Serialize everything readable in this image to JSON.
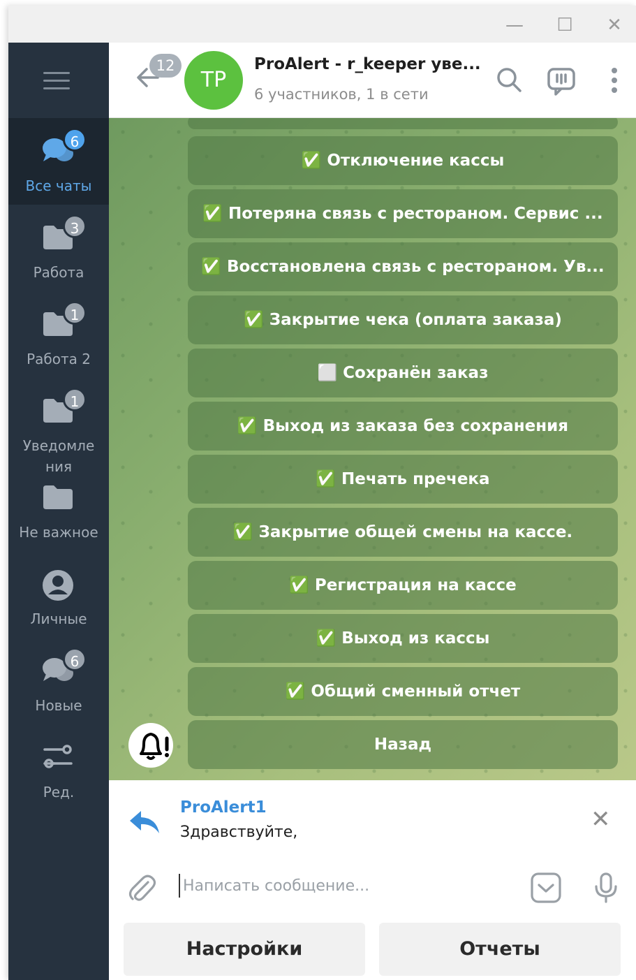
{
  "window": {
    "minimize": "—",
    "maximize": "☐",
    "close": "✕"
  },
  "sidebar": {
    "menu_icon": "hamburger-menu-icon",
    "folders": [
      {
        "label": "Все чаты",
        "badge": "6",
        "icon": "chats-bubble-icon",
        "active": true
      },
      {
        "label": "Работа",
        "badge": "3",
        "icon": "folder-icon"
      },
      {
        "label": "Работа 2",
        "badge": "1",
        "icon": "folder-icon"
      },
      {
        "label": "Уведомле ния",
        "badge": "1",
        "icon": "folder-icon"
      },
      {
        "label": "Не важное",
        "badge": "",
        "icon": "folder-icon"
      },
      {
        "label": "Личные",
        "badge": "",
        "icon": "person-icon"
      },
      {
        "label": "Новые",
        "badge": "6",
        "icon": "chats-bubble-icon"
      },
      {
        "label": "Ред.",
        "badge": "",
        "icon": "edit-sliders-icon"
      }
    ]
  },
  "header": {
    "back_badge": "12",
    "avatar_initials": "TP",
    "avatar_color": "#5cc13f",
    "title": "ProAlert - r_keeper уве...",
    "subtitle": "6 участников, 1 в сети"
  },
  "keyboard": [
    "✅ Отключение кассы",
    "✅ Потеряна связь с рестораном. Сервис ...",
    "✅ Восстановлена связь с рестораном. Ув...",
    "✅ Закрытие чека (оплата заказа)",
    "⬜ Сохранён заказ",
    "✅ Выход из заказа без сохранения",
    "✅ Печать пречека",
    "✅ Закрытие общей смены на кассе.",
    "✅ Регистрация на кассе",
    "✅ Выход из кассы",
    "✅ Общий сменный отчет",
    "Назад"
  ],
  "reply": {
    "name": "ProAlert1",
    "text": "Здравствуйте,"
  },
  "composer": {
    "placeholder": "Написать сообщение..."
  },
  "reply_keyboard": [
    "Настройки",
    "Отчеты"
  ],
  "colors": {
    "sidebar": "#26323f",
    "accent": "#4fa3ec"
  }
}
